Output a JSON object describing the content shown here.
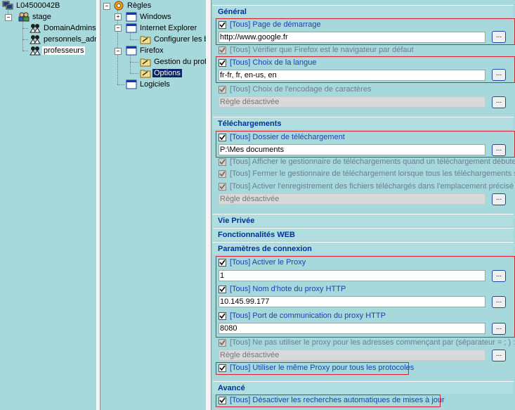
{
  "left_tree": {
    "root": "L04500042B",
    "group": "stage",
    "items": [
      "DomainAdmins",
      "personnels_adm",
      "professeurs"
    ]
  },
  "mid_tree": {
    "root": "Règles",
    "windows": "Windows",
    "ie": "Internet Explorer",
    "ie_child": "Configurer les b",
    "firefox": "Firefox",
    "ff_child1": "Gestion du profi",
    "ff_child2": "Options",
    "logiciels": "Logiciels"
  },
  "sections": {
    "general": "Général",
    "downloads": "Téléchargements",
    "privacy": "Vie Privée",
    "web": "Fonctionnalités WEB",
    "connection": "Paramètres de connexion",
    "advanced": "Avancé"
  },
  "options": {
    "homepage_label": "[Tous] Page de démarrage",
    "homepage_value": "http://www.google.fr",
    "default_browser_label": "[Tous] Vérifier que Firefox est le navigateur par défaut",
    "language_label": "[Tous] Choix de la langue",
    "language_value": "fr-fr, fr, en-us, en",
    "encoding_label": "[Tous] Choix de l'encodage de caractères",
    "disabled_rule": "Règle désactivée",
    "download_folder_label": "[Tous] Dossier de téléchargement",
    "download_folder_value": "P:\\Mes documents",
    "dl_show_label": "[Tous] Afficher le gestionnaire de téléchargements quand un téléchargement débute",
    "dl_close_label": "[Tous] Fermer le gestionnaire de téléchargement lorsque tous les téléchargements sont",
    "dl_save_label": "[Tous] Activer l'enregistrement des fichiers téléchargés dans l'emplacement précisé ci-",
    "proxy_enable_label": "[Tous] Activer le Proxy",
    "proxy_enable_value": "1",
    "proxy_host_label": "[Tous] Nom d'hote du proxy HTTP",
    "proxy_host_value": "10.145.99.177",
    "proxy_port_label": "[Tous] Port de communication du proxy HTTP",
    "proxy_port_value": "8080",
    "no_proxy_label": "[Tous] Ne pas utiliser le proxy pour les adresses commençant par (séparateur = ; )  :",
    "same_proxy_label": "[Tous] Utiliser le même Proxy pour tous les protocoles",
    "auto_update_label": "[Tous] Désactiver les recherches automatiques de mises à jour",
    "dots": "..."
  },
  "colors": {
    "panel_bg": "#a7d8dc",
    "section_title": "#003399",
    "option_text": "#1a44aa",
    "highlight_border": "#e0202a"
  }
}
